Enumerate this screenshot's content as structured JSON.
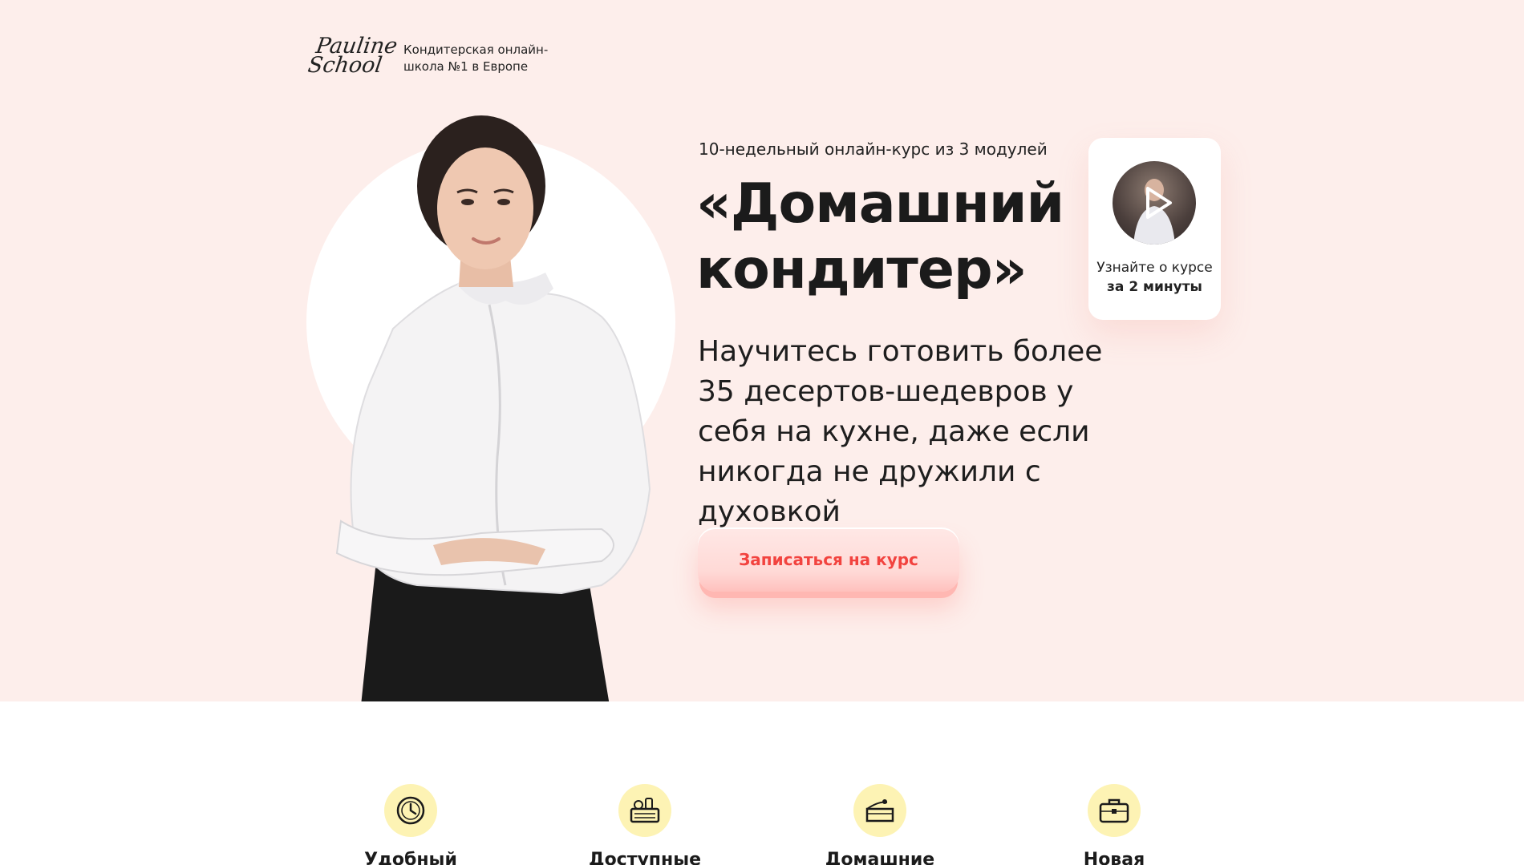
{
  "header": {
    "logo_line1": "Pauline",
    "logo_line2": "School",
    "tagline": "Кондитерская онлайн-школа №1 в Европе"
  },
  "hero": {
    "subtitle": "10-недельный онлайн-курс из 3 модулей",
    "title": "«Домашний кондитер»",
    "lead": "Научитесь готовить более 35 десертов-шедевров у себя на кухне, даже если никогда не дружили с духовкой",
    "cta_label": "Записаться на курс",
    "image_icon": "chef-photo"
  },
  "video_card": {
    "line1": "Узнайте о курсе",
    "line2": "за 2 минуты",
    "icon": "play-icon"
  },
  "features": [
    {
      "icon": "clock-icon",
      "label": "Удобный график"
    },
    {
      "icon": "basket-icon",
      "label": "Доступные продукты"
    },
    {
      "icon": "cake-icon",
      "label": "Домашние десерты"
    },
    {
      "icon": "briefcase-icon",
      "label": "Новая профессия"
    }
  ],
  "colors": {
    "hero_bg": "#fdeeeb",
    "cta_text": "#f2433f",
    "cta_bg": "#ffd9d6",
    "feature_icon_bg": "#fdf3b4"
  }
}
